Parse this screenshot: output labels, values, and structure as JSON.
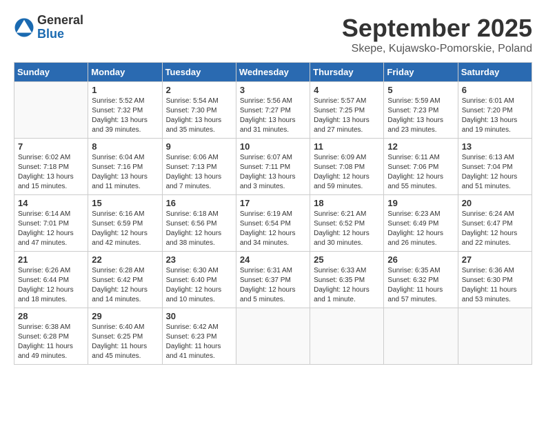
{
  "header": {
    "logo": {
      "general": "General",
      "blue": "Blue"
    },
    "title": "September 2025",
    "location": "Skepe, Kujawsko-Pomorskie, Poland"
  },
  "calendar": {
    "weekdays": [
      "Sunday",
      "Monday",
      "Tuesday",
      "Wednesday",
      "Thursday",
      "Friday",
      "Saturday"
    ],
    "weeks": [
      [
        {
          "day": "",
          "sunrise": "",
          "sunset": "",
          "daylight": ""
        },
        {
          "day": "1",
          "sunrise": "Sunrise: 5:52 AM",
          "sunset": "Sunset: 7:32 PM",
          "daylight": "Daylight: 13 hours and 39 minutes."
        },
        {
          "day": "2",
          "sunrise": "Sunrise: 5:54 AM",
          "sunset": "Sunset: 7:30 PM",
          "daylight": "Daylight: 13 hours and 35 minutes."
        },
        {
          "day": "3",
          "sunrise": "Sunrise: 5:56 AM",
          "sunset": "Sunset: 7:27 PM",
          "daylight": "Daylight: 13 hours and 31 minutes."
        },
        {
          "day": "4",
          "sunrise": "Sunrise: 5:57 AM",
          "sunset": "Sunset: 7:25 PM",
          "daylight": "Daylight: 13 hours and 27 minutes."
        },
        {
          "day": "5",
          "sunrise": "Sunrise: 5:59 AM",
          "sunset": "Sunset: 7:23 PM",
          "daylight": "Daylight: 13 hours and 23 minutes."
        },
        {
          "day": "6",
          "sunrise": "Sunrise: 6:01 AM",
          "sunset": "Sunset: 7:20 PM",
          "daylight": "Daylight: 13 hours and 19 minutes."
        }
      ],
      [
        {
          "day": "7",
          "sunrise": "Sunrise: 6:02 AM",
          "sunset": "Sunset: 7:18 PM",
          "daylight": "Daylight: 13 hours and 15 minutes."
        },
        {
          "day": "8",
          "sunrise": "Sunrise: 6:04 AM",
          "sunset": "Sunset: 7:16 PM",
          "daylight": "Daylight: 13 hours and 11 minutes."
        },
        {
          "day": "9",
          "sunrise": "Sunrise: 6:06 AM",
          "sunset": "Sunset: 7:13 PM",
          "daylight": "Daylight: 13 hours and 7 minutes."
        },
        {
          "day": "10",
          "sunrise": "Sunrise: 6:07 AM",
          "sunset": "Sunset: 7:11 PM",
          "daylight": "Daylight: 13 hours and 3 minutes."
        },
        {
          "day": "11",
          "sunrise": "Sunrise: 6:09 AM",
          "sunset": "Sunset: 7:08 PM",
          "daylight": "Daylight: 12 hours and 59 minutes."
        },
        {
          "day": "12",
          "sunrise": "Sunrise: 6:11 AM",
          "sunset": "Sunset: 7:06 PM",
          "daylight": "Daylight: 12 hours and 55 minutes."
        },
        {
          "day": "13",
          "sunrise": "Sunrise: 6:13 AM",
          "sunset": "Sunset: 7:04 PM",
          "daylight": "Daylight: 12 hours and 51 minutes."
        }
      ],
      [
        {
          "day": "14",
          "sunrise": "Sunrise: 6:14 AM",
          "sunset": "Sunset: 7:01 PM",
          "daylight": "Daylight: 12 hours and 47 minutes."
        },
        {
          "day": "15",
          "sunrise": "Sunrise: 6:16 AM",
          "sunset": "Sunset: 6:59 PM",
          "daylight": "Daylight: 12 hours and 42 minutes."
        },
        {
          "day": "16",
          "sunrise": "Sunrise: 6:18 AM",
          "sunset": "Sunset: 6:56 PM",
          "daylight": "Daylight: 12 hours and 38 minutes."
        },
        {
          "day": "17",
          "sunrise": "Sunrise: 6:19 AM",
          "sunset": "Sunset: 6:54 PM",
          "daylight": "Daylight: 12 hours and 34 minutes."
        },
        {
          "day": "18",
          "sunrise": "Sunrise: 6:21 AM",
          "sunset": "Sunset: 6:52 PM",
          "daylight": "Daylight: 12 hours and 30 minutes."
        },
        {
          "day": "19",
          "sunrise": "Sunrise: 6:23 AM",
          "sunset": "Sunset: 6:49 PM",
          "daylight": "Daylight: 12 hours and 26 minutes."
        },
        {
          "day": "20",
          "sunrise": "Sunrise: 6:24 AM",
          "sunset": "Sunset: 6:47 PM",
          "daylight": "Daylight: 12 hours and 22 minutes."
        }
      ],
      [
        {
          "day": "21",
          "sunrise": "Sunrise: 6:26 AM",
          "sunset": "Sunset: 6:44 PM",
          "daylight": "Daylight: 12 hours and 18 minutes."
        },
        {
          "day": "22",
          "sunrise": "Sunrise: 6:28 AM",
          "sunset": "Sunset: 6:42 PM",
          "daylight": "Daylight: 12 hours and 14 minutes."
        },
        {
          "day": "23",
          "sunrise": "Sunrise: 6:30 AM",
          "sunset": "Sunset: 6:40 PM",
          "daylight": "Daylight: 12 hours and 10 minutes."
        },
        {
          "day": "24",
          "sunrise": "Sunrise: 6:31 AM",
          "sunset": "Sunset: 6:37 PM",
          "daylight": "Daylight: 12 hours and 5 minutes."
        },
        {
          "day": "25",
          "sunrise": "Sunrise: 6:33 AM",
          "sunset": "Sunset: 6:35 PM",
          "daylight": "Daylight: 12 hours and 1 minute."
        },
        {
          "day": "26",
          "sunrise": "Sunrise: 6:35 AM",
          "sunset": "Sunset: 6:32 PM",
          "daylight": "Daylight: 11 hours and 57 minutes."
        },
        {
          "day": "27",
          "sunrise": "Sunrise: 6:36 AM",
          "sunset": "Sunset: 6:30 PM",
          "daylight": "Daylight: 11 hours and 53 minutes."
        }
      ],
      [
        {
          "day": "28",
          "sunrise": "Sunrise: 6:38 AM",
          "sunset": "Sunset: 6:28 PM",
          "daylight": "Daylight: 11 hours and 49 minutes."
        },
        {
          "day": "29",
          "sunrise": "Sunrise: 6:40 AM",
          "sunset": "Sunset: 6:25 PM",
          "daylight": "Daylight: 11 hours and 45 minutes."
        },
        {
          "day": "30",
          "sunrise": "Sunrise: 6:42 AM",
          "sunset": "Sunset: 6:23 PM",
          "daylight": "Daylight: 11 hours and 41 minutes."
        },
        {
          "day": "",
          "sunrise": "",
          "sunset": "",
          "daylight": ""
        },
        {
          "day": "",
          "sunrise": "",
          "sunset": "",
          "daylight": ""
        },
        {
          "day": "",
          "sunrise": "",
          "sunset": "",
          "daylight": ""
        },
        {
          "day": "",
          "sunrise": "",
          "sunset": "",
          "daylight": ""
        }
      ]
    ]
  }
}
